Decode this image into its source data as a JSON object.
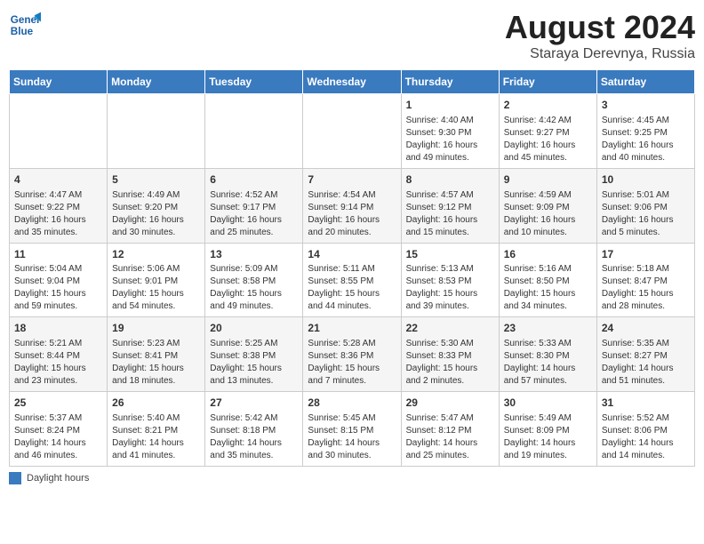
{
  "header": {
    "logo_text_top": "General",
    "logo_text_bottom": "Blue",
    "title": "August 2024",
    "subtitle": "Staraya Derevnya, Russia"
  },
  "days_of_week": [
    "Sunday",
    "Monday",
    "Tuesday",
    "Wednesday",
    "Thursday",
    "Friday",
    "Saturday"
  ],
  "legend_label": "Daylight hours",
  "weeks": [
    [
      {
        "day": "",
        "content": ""
      },
      {
        "day": "",
        "content": ""
      },
      {
        "day": "",
        "content": ""
      },
      {
        "day": "",
        "content": ""
      },
      {
        "day": "1",
        "content": "Sunrise: 4:40 AM\nSunset: 9:30 PM\nDaylight: 16 hours\nand 49 minutes."
      },
      {
        "day": "2",
        "content": "Sunrise: 4:42 AM\nSunset: 9:27 PM\nDaylight: 16 hours\nand 45 minutes."
      },
      {
        "day": "3",
        "content": "Sunrise: 4:45 AM\nSunset: 9:25 PM\nDaylight: 16 hours\nand 40 minutes."
      }
    ],
    [
      {
        "day": "4",
        "content": "Sunrise: 4:47 AM\nSunset: 9:22 PM\nDaylight: 16 hours\nand 35 minutes."
      },
      {
        "day": "5",
        "content": "Sunrise: 4:49 AM\nSunset: 9:20 PM\nDaylight: 16 hours\nand 30 minutes."
      },
      {
        "day": "6",
        "content": "Sunrise: 4:52 AM\nSunset: 9:17 PM\nDaylight: 16 hours\nand 25 minutes."
      },
      {
        "day": "7",
        "content": "Sunrise: 4:54 AM\nSunset: 9:14 PM\nDaylight: 16 hours\nand 20 minutes."
      },
      {
        "day": "8",
        "content": "Sunrise: 4:57 AM\nSunset: 9:12 PM\nDaylight: 16 hours\nand 15 minutes."
      },
      {
        "day": "9",
        "content": "Sunrise: 4:59 AM\nSunset: 9:09 PM\nDaylight: 16 hours\nand 10 minutes."
      },
      {
        "day": "10",
        "content": "Sunrise: 5:01 AM\nSunset: 9:06 PM\nDaylight: 16 hours\nand 5 minutes."
      }
    ],
    [
      {
        "day": "11",
        "content": "Sunrise: 5:04 AM\nSunset: 9:04 PM\nDaylight: 15 hours\nand 59 minutes."
      },
      {
        "day": "12",
        "content": "Sunrise: 5:06 AM\nSunset: 9:01 PM\nDaylight: 15 hours\nand 54 minutes."
      },
      {
        "day": "13",
        "content": "Sunrise: 5:09 AM\nSunset: 8:58 PM\nDaylight: 15 hours\nand 49 minutes."
      },
      {
        "day": "14",
        "content": "Sunrise: 5:11 AM\nSunset: 8:55 PM\nDaylight: 15 hours\nand 44 minutes."
      },
      {
        "day": "15",
        "content": "Sunrise: 5:13 AM\nSunset: 8:53 PM\nDaylight: 15 hours\nand 39 minutes."
      },
      {
        "day": "16",
        "content": "Sunrise: 5:16 AM\nSunset: 8:50 PM\nDaylight: 15 hours\nand 34 minutes."
      },
      {
        "day": "17",
        "content": "Sunrise: 5:18 AM\nSunset: 8:47 PM\nDaylight: 15 hours\nand 28 minutes."
      }
    ],
    [
      {
        "day": "18",
        "content": "Sunrise: 5:21 AM\nSunset: 8:44 PM\nDaylight: 15 hours\nand 23 minutes."
      },
      {
        "day": "19",
        "content": "Sunrise: 5:23 AM\nSunset: 8:41 PM\nDaylight: 15 hours\nand 18 minutes."
      },
      {
        "day": "20",
        "content": "Sunrise: 5:25 AM\nSunset: 8:38 PM\nDaylight: 15 hours\nand 13 minutes."
      },
      {
        "day": "21",
        "content": "Sunrise: 5:28 AM\nSunset: 8:36 PM\nDaylight: 15 hours\nand 7 minutes."
      },
      {
        "day": "22",
        "content": "Sunrise: 5:30 AM\nSunset: 8:33 PM\nDaylight: 15 hours\nand 2 minutes."
      },
      {
        "day": "23",
        "content": "Sunrise: 5:33 AM\nSunset: 8:30 PM\nDaylight: 14 hours\nand 57 minutes."
      },
      {
        "day": "24",
        "content": "Sunrise: 5:35 AM\nSunset: 8:27 PM\nDaylight: 14 hours\nand 51 minutes."
      }
    ],
    [
      {
        "day": "25",
        "content": "Sunrise: 5:37 AM\nSunset: 8:24 PM\nDaylight: 14 hours\nand 46 minutes."
      },
      {
        "day": "26",
        "content": "Sunrise: 5:40 AM\nSunset: 8:21 PM\nDaylight: 14 hours\nand 41 minutes."
      },
      {
        "day": "27",
        "content": "Sunrise: 5:42 AM\nSunset: 8:18 PM\nDaylight: 14 hours\nand 35 minutes."
      },
      {
        "day": "28",
        "content": "Sunrise: 5:45 AM\nSunset: 8:15 PM\nDaylight: 14 hours\nand 30 minutes."
      },
      {
        "day": "29",
        "content": "Sunrise: 5:47 AM\nSunset: 8:12 PM\nDaylight: 14 hours\nand 25 minutes."
      },
      {
        "day": "30",
        "content": "Sunrise: 5:49 AM\nSunset: 8:09 PM\nDaylight: 14 hours\nand 19 minutes."
      },
      {
        "day": "31",
        "content": "Sunrise: 5:52 AM\nSunset: 8:06 PM\nDaylight: 14 hours\nand 14 minutes."
      }
    ]
  ]
}
